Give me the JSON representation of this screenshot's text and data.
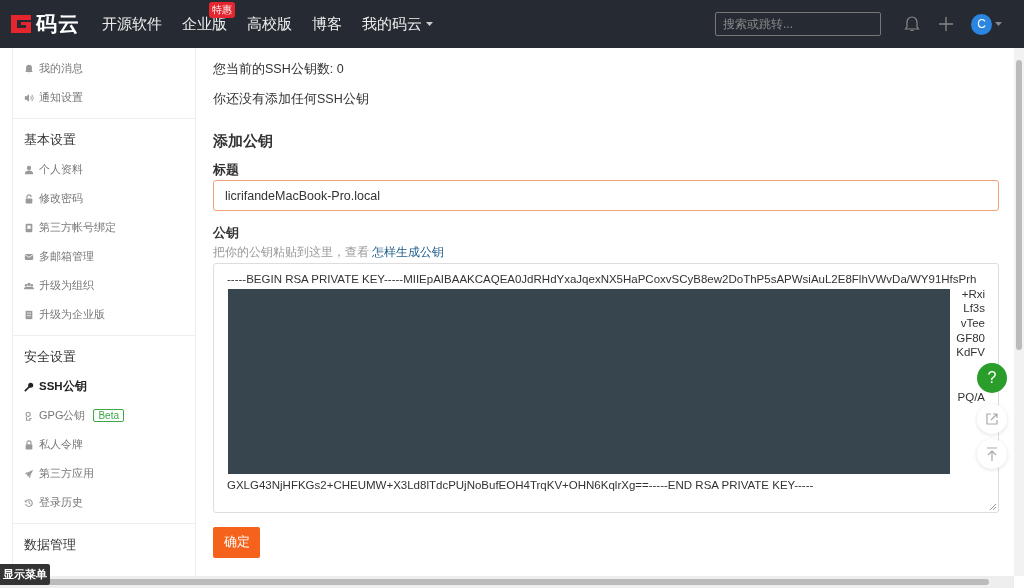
{
  "header": {
    "logo": "码云",
    "nav": [
      {
        "label": "开源软件"
      },
      {
        "label": "企业版",
        "badge": "特惠"
      },
      {
        "label": "高校版"
      },
      {
        "label": "博客"
      },
      {
        "label": "我的码云",
        "dropdown": true
      }
    ],
    "search": {
      "placeholder": "搜索或跳转..."
    },
    "avatar": "C"
  },
  "sidebar": {
    "sections": [
      {
        "items": [
          {
            "label": "我的消息",
            "selected": false
          },
          {
            "label": "通知设置",
            "selected": false
          }
        ]
      },
      {
        "title": "基本设置",
        "items": [
          {
            "label": "个人资料",
            "selected": false
          },
          {
            "label": "修改密码",
            "selected": false
          },
          {
            "label": "第三方帐号绑定",
            "selected": false
          },
          {
            "label": "多邮箱管理",
            "selected": false
          },
          {
            "label": "升级为组织",
            "selected": false
          },
          {
            "label": "升级为企业版",
            "selected": false
          }
        ]
      },
      {
        "title": "安全设置",
        "items": [
          {
            "label": "SSH公钥",
            "selected": true
          },
          {
            "label": "GPG公钥",
            "selected": false,
            "badge": "Beta"
          },
          {
            "label": "私人令牌",
            "selected": false
          },
          {
            "label": "第三方应用",
            "selected": false
          },
          {
            "label": "登录历史",
            "selected": false
          }
        ]
      },
      {
        "title": "数据管理"
      }
    ]
  },
  "main": {
    "key_count": "您当前的SSH公钥数: 0",
    "empty_note": "你还没有添加任何SSH公钥",
    "form_title": "添加公钥",
    "title_field": {
      "label": "标题",
      "value": "licrifandeMacBook-Pro.local"
    },
    "key_field": {
      "label": "公钥",
      "hint": "把你的公钥粘贴到这里，查看 ",
      "hint_link": "怎样生成公钥",
      "first_line": "-----BEGIN RSA PRIVATE KEY-----MIIEpAIBAAKCAQEA0JdRHdYxaJqexNX5HaPCoxvSCyB8ew2DoThP5sAPWsiAuL2E8FlhVWvDa/WY91HfsPrh",
      "line_ends": [
        {
          "text": "+Rxi"
        },
        {
          "text": "Lf3s"
        },
        {
          "text": "vTee"
        },
        {
          "text": "GF80"
        },
        {
          "text": "KdFV"
        },
        {
          "text": "PQ/A"
        }
      ],
      "last_line": "GXLG43NjHFKGs2+CHEUMW+X3Ld8lTdcPUjNoBufEOH4TrqKV+OHN6KqlrXg==-----END RSA PRIVATE KEY-----"
    },
    "submit": "确定"
  },
  "floating": {
    "help": "?"
  },
  "menu_toggle": "显示菜单"
}
